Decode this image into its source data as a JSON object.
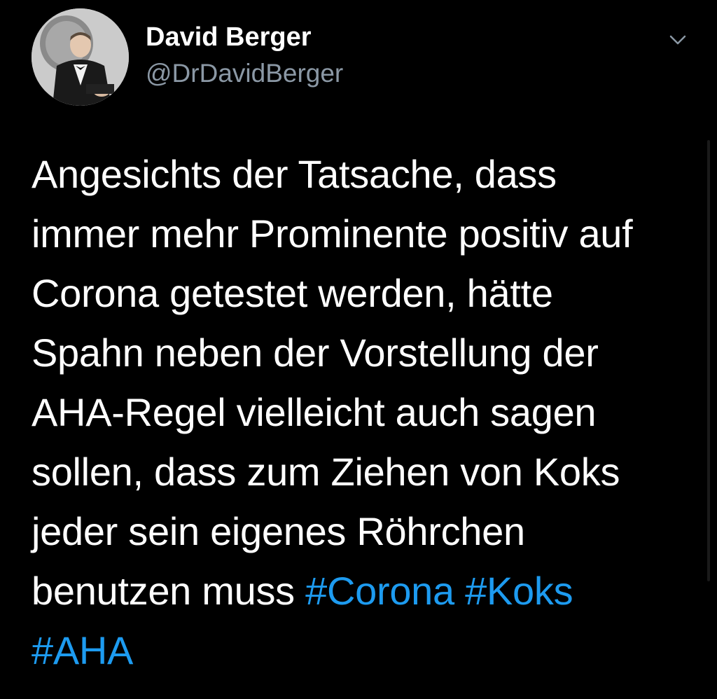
{
  "author": {
    "name": "David Berger",
    "handle": "@DrDavidBerger",
    "avatar_icon": "profile-photo-man-in-tuxedo"
  },
  "menu": {
    "icon": "chevron-down-icon"
  },
  "tweet": {
    "lines": [
      "Angesichts der Tatsache, dass",
      "immer mehr Prominente positiv auf",
      "Corona getestet werden, hätte",
      "Spahn neben der Vorstellung der",
      "AHA-Regel vielleicht auch sagen",
      "sollen, dass zum Ziehen von Koks",
      "jeder sein eigenes Röhrchen",
      "benutzen muss "
    ],
    "hashtags": [
      "#Corona",
      "#Koks",
      "#AHA"
    ]
  },
  "colors": {
    "background": "#000000",
    "text": "#ffffff",
    "secondary": "#8b98a5",
    "hashtag": "#1d9bf0"
  }
}
